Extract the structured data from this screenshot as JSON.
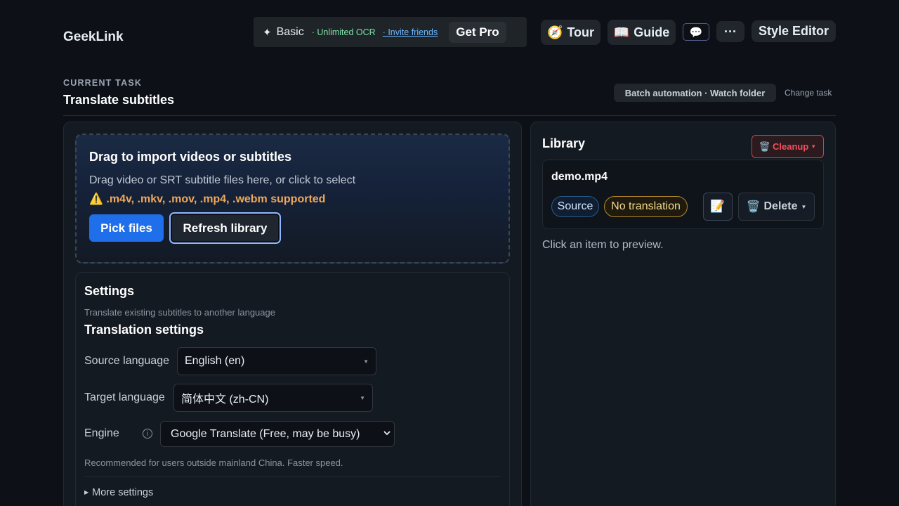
{
  "header": {
    "brand": "GeekLink",
    "plan": {
      "spark_icon": "✦",
      "name": "Basic",
      "ocr": "· Unlimited OCR",
      "invite": "· Invite friends",
      "get_pro": "Get Pro"
    },
    "tour": {
      "icon": "🧭",
      "label": "Tour"
    },
    "guide": {
      "icon": "📖",
      "label": "Guide"
    },
    "chat_icon": "💬",
    "more_icon": "···",
    "style_editor": "Style Editor"
  },
  "task": {
    "eyebrow": "CURRENT TASK",
    "title": "Translate subtitles",
    "batch": "Batch automation · Watch folder",
    "change": "Change task"
  },
  "import": {
    "title": "Drag to import videos or subtitles",
    "desc": "Drag video or SRT subtitle files here, or click to select",
    "formats": "⚠️ .m4v, .mkv, .mov, .mp4, .webm supported",
    "pick": "Pick files",
    "refresh": "Refresh library"
  },
  "settings": {
    "title": "Settings",
    "subtitle": "Translate existing subtitles to another language",
    "translation_title": "Translation settings",
    "source_label": "Source language",
    "source_value": "English (en)",
    "target_label": "Target language",
    "target_value": "简体中文 (zh-CN)",
    "engine_label": "Engine",
    "engine_value": "Google Translate (Free, may be busy)",
    "recommend": "Recommended for users outside mainland China. Faster speed.",
    "more": "More settings"
  },
  "library": {
    "title": "Library",
    "cleanup": "Cleanup",
    "cleanup_icon": "🗑️",
    "item": {
      "name": "demo.mp4",
      "tag_source": "Source",
      "tag_status": "No translation",
      "edit_icon": "📝",
      "delete": "Delete",
      "delete_icon": "🗑️"
    },
    "hint": "Click an item to preview."
  },
  "colors": {
    "background": "#0d1117",
    "accent": "#1f6feb",
    "warning": "#f0a85a",
    "danger": "#f0505c"
  }
}
